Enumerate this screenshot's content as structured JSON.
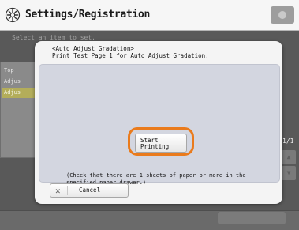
{
  "header": {
    "title": "Settings/Registration",
    "icon": "settings-gear-icon"
  },
  "background": {
    "instruction": "Select an item to set.",
    "list_items": [
      "Top",
      "Adjus",
      "Adjus"
    ],
    "page_indicator": "1/1",
    "scroll_up_icon": "▲",
    "scroll_down_icon": "▼"
  },
  "dialog": {
    "heading": "<Auto Adjust Gradation>",
    "subheading": "Print Test Page 1 for Auto Adjust Gradation.",
    "start_button_label": "Start\nPrinting",
    "note": "(Check that there are 1 sheets of paper or more in the specified paper drawer.)",
    "cancel_icon": "✕",
    "cancel_label": "Cancel"
  },
  "colors": {
    "highlight": "#ea7b1c",
    "panel": "#d3d6e0",
    "list_selected": "#eae06a"
  }
}
